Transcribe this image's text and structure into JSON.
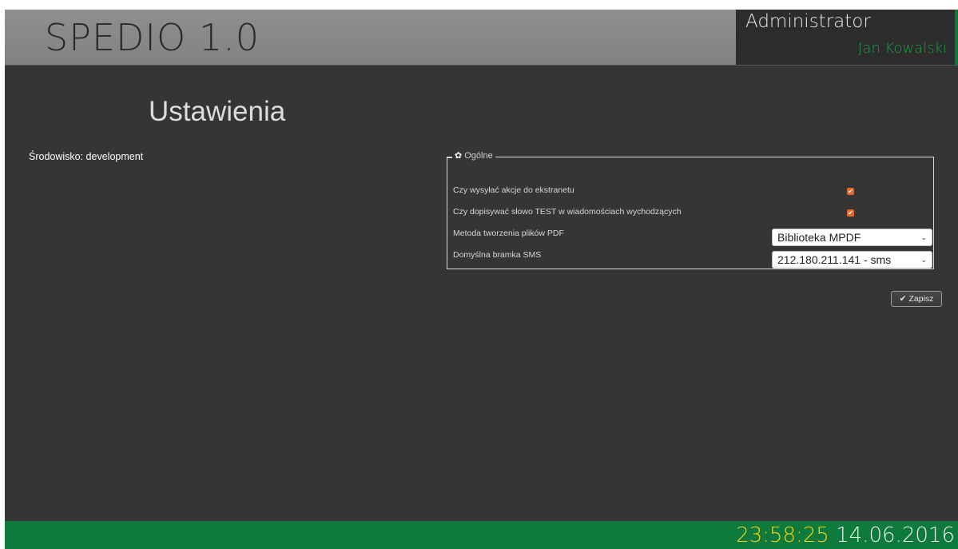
{
  "header": {
    "app_title": "SPEDIO 1.0",
    "user_role": "Administrator",
    "user_name": "Jan Kowalski"
  },
  "page": {
    "title": "Ustawienia",
    "environment_label": "Środowisko: development"
  },
  "settings": {
    "legend": "Ogólne",
    "legend_icon": "gear-icon",
    "rows": [
      {
        "label": "Czy wysyłać akcje do ekstranetu",
        "type": "checkbox",
        "checked": true
      },
      {
        "label": "Czy dopisywać słowo TEST w wiadomościach wychodzących",
        "type": "checkbox",
        "checked": true
      },
      {
        "label": "Metoda tworzenia plików PDF",
        "type": "select",
        "value": "Biblioteka MPDF"
      },
      {
        "label": "Domyślna bramka SMS",
        "type": "select",
        "value": "212.180.211.141 - sms"
      }
    ]
  },
  "actions": {
    "save_label": "Zapisz",
    "save_icon": "check-icon"
  },
  "footer": {
    "time": "23:58:25",
    "date": "14.06.2016"
  },
  "colors": {
    "background": "#353535",
    "accent_green": "#0e7a3b",
    "username_green": "#1c9b46",
    "checkbox_orange": "#e8652f",
    "clock_yellow": "#f2d21b"
  }
}
